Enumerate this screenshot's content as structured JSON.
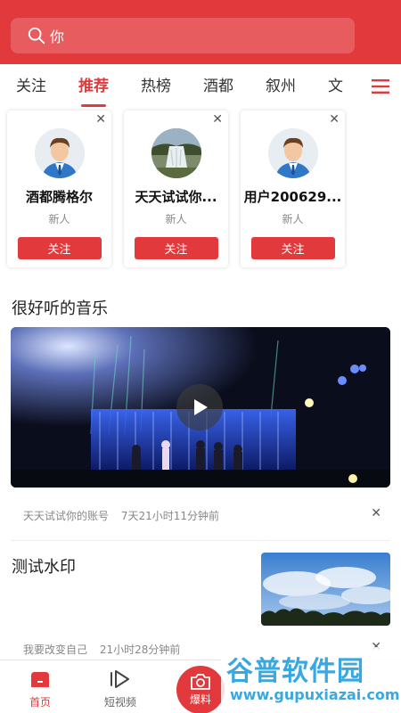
{
  "search": {
    "text": "你"
  },
  "tabs": [
    {
      "label": "关注"
    },
    {
      "label": "推荐"
    },
    {
      "label": "热榜"
    },
    {
      "label": "酒都"
    },
    {
      "label": "叙州"
    },
    {
      "label": "文"
    }
  ],
  "cards": [
    {
      "name": "酒都腾格尔",
      "tag": "新人",
      "button": "关注"
    },
    {
      "name": "天天试试你...",
      "tag": "新人",
      "button": "关注"
    },
    {
      "name": "用户200629...",
      "tag": "新人",
      "button": "关注"
    }
  ],
  "post1": {
    "title": "很好听的音乐",
    "author": "天天试试你的账号",
    "time": "7天21小时11分钟前"
  },
  "post2": {
    "title": "测试水印",
    "author": "我要改变自己",
    "time": "21小时28分钟前"
  },
  "nav": {
    "home": "首页",
    "short_video": "短视频",
    "report": "爆料"
  },
  "watermark": {
    "text": "谷普软件园",
    "url": "www.gupuxiazai.com"
  },
  "colors": {
    "accent": "#e23a3c"
  }
}
